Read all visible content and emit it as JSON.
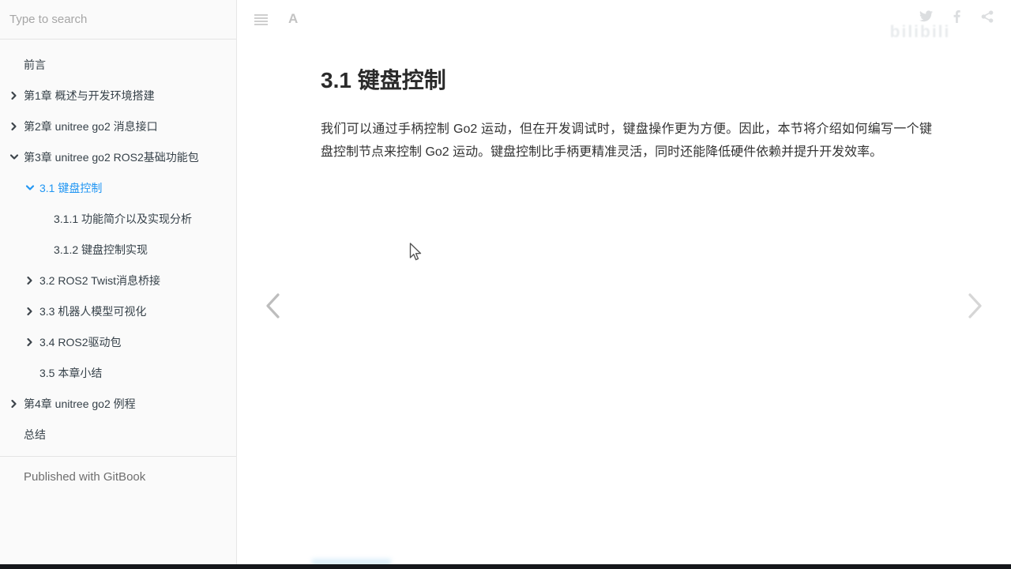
{
  "sidebar": {
    "search_placeholder": "Type to search",
    "items": [
      {
        "label": "前言",
        "level": 0,
        "expand": "none",
        "active": false
      },
      {
        "label": "第1章 概述与开发环境搭建",
        "level": 0,
        "expand": "right",
        "active": false
      },
      {
        "label": "第2章 unitree go2 消息接口",
        "level": 0,
        "expand": "right",
        "active": false
      },
      {
        "label": "第3章 unitree go2 ROS2基础功能包",
        "level": 0,
        "expand": "down",
        "active": false
      },
      {
        "label": "3.1 键盘控制",
        "level": 1,
        "expand": "down",
        "active": true
      },
      {
        "label": "3.1.1 功能简介以及实现分析",
        "level": 2,
        "expand": "none",
        "active": false
      },
      {
        "label": "3.1.2 键盘控制实现",
        "level": 2,
        "expand": "none",
        "active": false
      },
      {
        "label": "3.2 ROS2 Twist消息桥接",
        "level": 1,
        "expand": "right",
        "active": false
      },
      {
        "label": "3.3 机器人模型可视化",
        "level": 1,
        "expand": "right",
        "active": false
      },
      {
        "label": "3.4 ROS2驱动包",
        "level": 1,
        "expand": "right",
        "active": false
      },
      {
        "label": "3.5 本章小结",
        "level": 1,
        "expand": "none",
        "active": false
      },
      {
        "label": "第4章 unitree go2 例程",
        "level": 0,
        "expand": "right",
        "active": false
      },
      {
        "label": "总结",
        "level": 0,
        "expand": "none",
        "active": false
      }
    ],
    "footer": "Published with GitBook"
  },
  "toolbar": {
    "font_icon_glyph": "A",
    "icons": [
      "menu-icon",
      "font-settings-icon",
      "twitter-icon",
      "facebook-icon",
      "share-icon"
    ]
  },
  "content": {
    "title": "3.1 键盘控制",
    "paragraph": "我们可以通过手柄控制 Go2 运动，但在开发调试时，键盘操作更为方便。因此，本节将介绍如何编写一个键盘控制节点来控制 Go2 运动。键盘控制比手柄更精准灵活，同时还能降低硬件依赖并提升开发效率。"
  },
  "watermark": {
    "text": "bilibili"
  },
  "colors": {
    "accent_active_link": "#2196f3",
    "sidebar_bg": "#fafafa",
    "sidebar_text": "#364149",
    "body_text": "#333333",
    "player_bar": "#15171b"
  }
}
